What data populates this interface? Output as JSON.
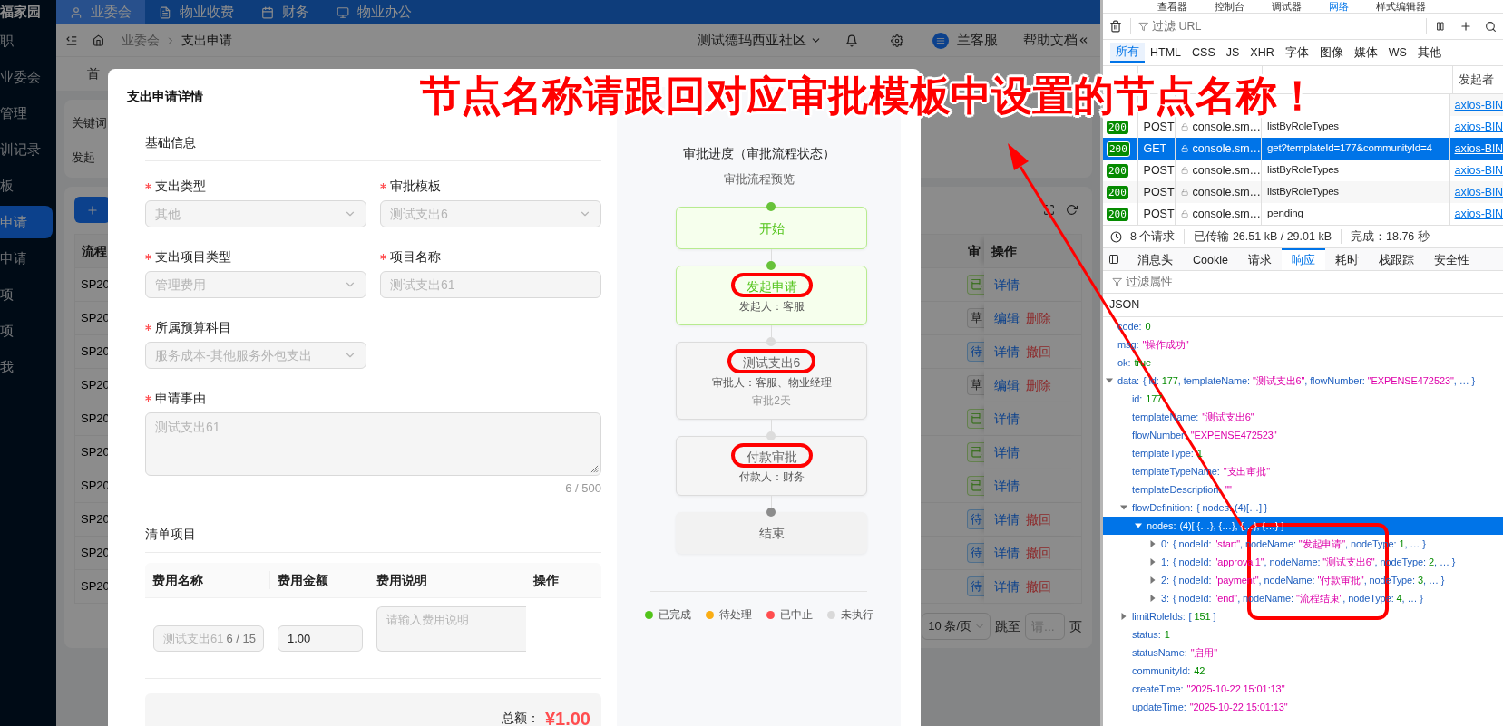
{
  "sidebar": {
    "brand": "福家园",
    "items": [
      {
        "label": "职",
        "selected": false
      },
      {
        "label": "业委会",
        "selected": false
      },
      {
        "label": "管理",
        "selected": false
      },
      {
        "label": "训记录",
        "selected": false
      },
      {
        "label": "板",
        "selected": false
      },
      {
        "label": "申请",
        "selected": true
      },
      {
        "label": "申请",
        "selected": false
      },
      {
        "label": "项",
        "selected": false
      },
      {
        "label": "项",
        "selected": false
      },
      {
        "label": "我",
        "selected": false
      }
    ]
  },
  "top_nav": {
    "tabs": [
      {
        "label": "业委会",
        "selected": true
      },
      {
        "label": "物业收费",
        "selected": false
      },
      {
        "label": "财务",
        "selected": false
      },
      {
        "label": "物业办公",
        "selected": false
      }
    ]
  },
  "header": {
    "breadcrumb": [
      "业委会",
      "支出申请"
    ],
    "community": "测试德玛西亚社区",
    "user": "兰客服",
    "help": "帮助文档"
  },
  "page_tabs": [
    "首"
  ],
  "filters": [
    "关键词",
    "发起"
  ],
  "list": {
    "columns": [
      "流程",
      "审",
      "操作"
    ],
    "rows": [
      {
        "number": "SP20",
        "status": {
          "label": "已",
          "kind": "done"
        },
        "actions": [
          {
            "label": "详情",
            "kind": "normal"
          }
        ]
      },
      {
        "number": "SP20",
        "status": {
          "label": "草",
          "kind": "draft"
        },
        "actions": [
          {
            "label": "编辑",
            "kind": "normal"
          },
          {
            "label": "删除",
            "kind": "danger"
          }
        ]
      },
      {
        "number": "SP20",
        "status": {
          "label": "待",
          "kind": "pending"
        },
        "actions": [
          {
            "label": "详情",
            "kind": "normal"
          },
          {
            "label": "撤回",
            "kind": "danger"
          }
        ]
      },
      {
        "number": "SP20",
        "status": {
          "label": "草",
          "kind": "draft"
        },
        "actions": [
          {
            "label": "编辑",
            "kind": "normal"
          },
          {
            "label": "删除",
            "kind": "danger"
          }
        ]
      },
      {
        "number": "SP20",
        "status": {
          "label": "已",
          "kind": "done"
        },
        "actions": [
          {
            "label": "详情",
            "kind": "normal"
          }
        ]
      },
      {
        "number": "SP20",
        "status": {
          "label": "已",
          "kind": "done"
        },
        "actions": [
          {
            "label": "详情",
            "kind": "normal"
          }
        ]
      },
      {
        "number": "SP20",
        "status": {
          "label": "已",
          "kind": "done"
        },
        "actions": [
          {
            "label": "详情",
            "kind": "normal"
          }
        ]
      },
      {
        "number": "SP20",
        "status": {
          "label": "待",
          "kind": "pending"
        },
        "actions": [
          {
            "label": "详情",
            "kind": "normal"
          },
          {
            "label": "撤回",
            "kind": "danger"
          }
        ]
      },
      {
        "number": "SP20",
        "status": {
          "label": "待",
          "kind": "pending"
        },
        "actions": [
          {
            "label": "详情",
            "kind": "normal"
          },
          {
            "label": "撤回",
            "kind": "danger"
          }
        ]
      },
      {
        "number": "SP20",
        "status": {
          "label": "待",
          "kind": "pending"
        },
        "actions": [
          {
            "label": "详情",
            "kind": "normal"
          },
          {
            "label": "撤回",
            "kind": "danger"
          }
        ]
      }
    ],
    "pagination": {
      "page_size": "10 条/页",
      "jump_label": "跳至",
      "jump_placeholder": "请...",
      "page_suffix": "页"
    }
  },
  "modal": {
    "title": "支出申请详情",
    "basic_title": "基础信息",
    "fields": [
      {
        "kind": "select",
        "label": "支出类型",
        "required": true,
        "disabled": true,
        "value": "其他"
      },
      {
        "kind": "select",
        "label": "审批模板",
        "required": true,
        "disabled": true,
        "value": "测试支出6"
      },
      {
        "kind": "select",
        "label": "支出项目类型",
        "required": true,
        "disabled": true,
        "value": "管理费用"
      },
      {
        "kind": "input",
        "label": "项目名称",
        "required": true,
        "disabled": true,
        "value": "测试支出61"
      },
      {
        "kind": "select",
        "label": "所属预算科目",
        "required": true,
        "disabled": true,
        "value": "服务成本-其他服务外包支出"
      },
      {
        "kind": "textarea",
        "label": "申请事由",
        "required": true,
        "disabled": true,
        "value": "测试支出61",
        "count": "6 / 500"
      }
    ],
    "items_title": "清单项目",
    "items_columns": [
      "费用名称",
      "费用金额",
      "费用说明",
      "操作"
    ],
    "items": [
      {
        "name": "测试支出61",
        "name_count": "6 / 15",
        "name_disabled": true,
        "amount": "1.00",
        "description_placeholder": "请输入费用说明"
      }
    ],
    "total_label": "总额：",
    "total": "¥1.00"
  },
  "flow": {
    "title": "审批进度（审批流程状态）",
    "subtitle": "审批流程预览",
    "nodes": [
      {
        "kind": "start",
        "title": "开始",
        "completed": true,
        "highlighted": false
      },
      {
        "kind": "task",
        "title": "发起申请",
        "details": [
          "发起人：客服"
        ],
        "completed": true,
        "highlighted": true
      },
      {
        "kind": "task",
        "title": "测试支出6",
        "details": [
          "审批人：客服、物业经理"
        ],
        "note": "审批2天",
        "completed": false,
        "highlighted": true
      },
      {
        "kind": "task",
        "title": "付款审批",
        "details": [
          "付款人：财务"
        ],
        "completed": false,
        "highlighted": true
      },
      {
        "kind": "end",
        "title": "结束",
        "completed": false,
        "highlighted": false
      }
    ],
    "legend": [
      {
        "label": "已完成",
        "color": "#52c41a"
      },
      {
        "label": "待处理",
        "color": "#faad14"
      },
      {
        "label": "已中止",
        "color": "#ff4d4f"
      },
      {
        "label": "未执行",
        "color": "#d9d9d9"
      }
    ]
  },
  "devtools": {
    "toolbar": [
      {
        "label": "查看器",
        "selected": false
      },
      {
        "label": "控制台",
        "selected": false
      },
      {
        "label": "调试器",
        "selected": false
      },
      {
        "label": "网络",
        "selected": true
      },
      {
        "label": "样式编辑器",
        "selected": false
      }
    ],
    "url_filter_placeholder": "过滤 URL",
    "type_filters": [
      {
        "label": "所有",
        "selected": true
      },
      {
        "label": "HTML",
        "selected": false
      },
      {
        "label": "CSS",
        "selected": false
      },
      {
        "label": "JS",
        "selected": false
      },
      {
        "label": "XHR",
        "selected": false
      },
      {
        "label": "字体",
        "selected": false
      },
      {
        "label": "图像",
        "selected": false
      },
      {
        "label": "媒体",
        "selected": false
      },
      {
        "label": "WS",
        "selected": false
      },
      {
        "label": "其他",
        "selected": false
      }
    ],
    "initiator_column": "发起者",
    "requests": [
      {
        "initiator": "axios-BlN",
        "selected": false
      },
      {
        "status": "200",
        "method": "POST",
        "domain": "console.sm…",
        "file": "listByRoleTypes",
        "initiator": "axios-BlN",
        "selected": false
      },
      {
        "status": "200",
        "method": "GET",
        "domain": "console.sm…",
        "file": "get?templateId=177&communityId=4",
        "initiator": "axios-BlN",
        "selected": true
      },
      {
        "status": "200",
        "method": "POST",
        "domain": "console.sm…",
        "file": "listByRoleTypes",
        "initiator": "axios-BlN",
        "selected": false
      },
      {
        "status": "200",
        "method": "POST",
        "domain": "console.sm…",
        "file": "listByRoleTypes",
        "initiator": "axios-BlN",
        "selected": false
      },
      {
        "status": "200",
        "method": "POST",
        "domain": "console.sm…",
        "file": "pending",
        "initiator": "axios-BlN",
        "selected": false
      }
    ],
    "summary": [
      "8 个请求",
      "已传输 26.51 kB / 29.01 kB",
      "完成：18.76 秒"
    ],
    "detail_tabs": [
      {
        "label": "消息头",
        "selected": false
      },
      {
        "label": "Cookie",
        "selected": false
      },
      {
        "label": "请求",
        "selected": false
      },
      {
        "label": "响应",
        "selected": true
      },
      {
        "label": "耗时",
        "selected": false
      },
      {
        "label": "栈跟踪",
        "selected": false
      },
      {
        "label": "安全性",
        "selected": false
      }
    ],
    "prop_filter_placeholder": "过滤属性",
    "json_label": "JSON",
    "tree": [
      {
        "key": "code:",
        "selected": false,
        "parts": [
          {
            "text": "0",
            "kind": "number"
          }
        ]
      },
      {
        "key": "msg:",
        "selected": false,
        "parts": [
          {
            "text": "\"操作成功\"",
            "kind": "string"
          }
        ]
      },
      {
        "key": "ok:",
        "selected": false,
        "parts": [
          {
            "text": "true",
            "kind": "number"
          }
        ]
      },
      {
        "key": "data:",
        "selected": false,
        "expanded": true,
        "parts": [
          {
            "text": "{ id: ",
            "kind": "plain"
          },
          {
            "text": "177",
            "kind": "number"
          },
          {
            "text": ", templateName: ",
            "kind": "plain"
          },
          {
            "text": "\"测试支出6\"",
            "kind": "string"
          },
          {
            "text": ", flowNumber: ",
            "kind": "plain"
          },
          {
            "text": "\"EXPENSE472523\"",
            "kind": "string"
          },
          {
            "text": ", … }",
            "kind": "plain"
          }
        ],
        "children": [
          {
            "key": "id:",
            "selected": false,
            "parts": [
              {
                "text": "177",
                "kind": "number"
              }
            ]
          },
          {
            "key": "templateName:",
            "selected": false,
            "parts": [
              {
                "text": "\"测试支出6\"",
                "kind": "string"
              }
            ]
          },
          {
            "key": "flowNumber:",
            "selected": false,
            "parts": [
              {
                "text": "\"EXPENSE472523\"",
                "kind": "string"
              }
            ]
          },
          {
            "key": "templateType:",
            "selected": false,
            "parts": [
              {
                "text": "1",
                "kind": "number"
              }
            ]
          },
          {
            "key": "templateTypeName:",
            "selected": false,
            "parts": [
              {
                "text": "\"支出审批\"",
                "kind": "string"
              }
            ]
          },
          {
            "key": "templateDescription:",
            "selected": false,
            "parts": [
              {
                "text": "\"\"",
                "kind": "string"
              }
            ]
          },
          {
            "key": "flowDefinition:",
            "selected": false,
            "expanded": true,
            "parts": [
              {
                "text": "{ nodes: (4)[…] }",
                "kind": "plain"
              }
            ],
            "children": [
              {
                "key": "nodes:",
                "selected": true,
                "expanded": true,
                "parts": [
                  {
                    "text": "(4)[ {…}, {…}, {…}, {…} ]",
                    "kind": "plain"
                  }
                ],
                "children": [
                  {
                    "key": "0:",
                    "selected": false,
                    "expanded": false,
                    "parts": [
                      {
                        "text": "{ nodeId: ",
                        "kind": "plain"
                      },
                      {
                        "text": "\"start\"",
                        "kind": "string"
                      },
                      {
                        "text": ", nodeName: ",
                        "kind": "plain"
                      },
                      {
                        "text": "\"发起申请\"",
                        "kind": "string"
                      },
                      {
                        "text": ", nodeType: ",
                        "kind": "plain"
                      },
                      {
                        "text": "1",
                        "kind": "number"
                      },
                      {
                        "text": ", … }",
                        "kind": "plain"
                      }
                    ]
                  },
                  {
                    "key": "1:",
                    "selected": false,
                    "expanded": false,
                    "parts": [
                      {
                        "text": "{ nodeId: ",
                        "kind": "plain"
                      },
                      {
                        "text": "\"approval1\"",
                        "kind": "string"
                      },
                      {
                        "text": ", nodeName: ",
                        "kind": "plain"
                      },
                      {
                        "text": "\"测试支出6\"",
                        "kind": "string"
                      },
                      {
                        "text": ", nodeType: ",
                        "kind": "plain"
                      },
                      {
                        "text": "2",
                        "kind": "number"
                      },
                      {
                        "text": ", … }",
                        "kind": "plain"
                      }
                    ]
                  },
                  {
                    "key": "2:",
                    "selected": false,
                    "expanded": false,
                    "parts": [
                      {
                        "text": "{ nodeId: ",
                        "kind": "plain"
                      },
                      {
                        "text": "\"payment\"",
                        "kind": "string"
                      },
                      {
                        "text": ", nodeName: ",
                        "kind": "plain"
                      },
                      {
                        "text": "\"付款审批\"",
                        "kind": "string"
                      },
                      {
                        "text": ", nodeType: ",
                        "kind": "plain"
                      },
                      {
                        "text": "3",
                        "kind": "number"
                      },
                      {
                        "text": ", … }",
                        "kind": "plain"
                      }
                    ]
                  },
                  {
                    "key": "3:",
                    "selected": false,
                    "expanded": false,
                    "parts": [
                      {
                        "text": "{ nodeId: ",
                        "kind": "plain"
                      },
                      {
                        "text": "\"end\"",
                        "kind": "string"
                      },
                      {
                        "text": ", nodeName: ",
                        "kind": "plain"
                      },
                      {
                        "text": "\"流程结束\"",
                        "kind": "string"
                      },
                      {
                        "text": ", nodeType: ",
                        "kind": "plain"
                      },
                      {
                        "text": "4",
                        "kind": "number"
                      },
                      {
                        "text": ", … }",
                        "kind": "plain"
                      }
                    ]
                  }
                ]
              }
            ]
          },
          {
            "key": "limitRoleIds:",
            "selected": false,
            "expanded": false,
            "parts": [
              {
                "text": "[ ",
                "kind": "plain"
              },
              {
                "text": "151",
                "kind": "number"
              },
              {
                "text": " ]",
                "kind": "plain"
              }
            ]
          },
          {
            "key": "status:",
            "selected": false,
            "parts": [
              {
                "text": "1",
                "kind": "number"
              }
            ]
          },
          {
            "key": "statusName:",
            "selected": false,
            "parts": [
              {
                "text": "\"启用\"",
                "kind": "string"
              }
            ]
          },
          {
            "key": "communityId:",
            "selected": false,
            "parts": [
              {
                "text": "42",
                "kind": "number"
              }
            ]
          },
          {
            "key": "createTime:",
            "selected": false,
            "parts": [
              {
                "text": "\"2025-10-22 15:01:13\"",
                "kind": "string"
              }
            ]
          },
          {
            "key": "updateTime:",
            "selected": false,
            "parts": [
              {
                "text": "\"2025-10-22 15:01:13\"",
                "kind": "string"
              }
            ]
          }
        ]
      }
    ]
  },
  "annotation": {
    "text": "节点名称请跟回对应审批模板中设置的节点名称！",
    "arrow": true,
    "frame": true
  }
}
